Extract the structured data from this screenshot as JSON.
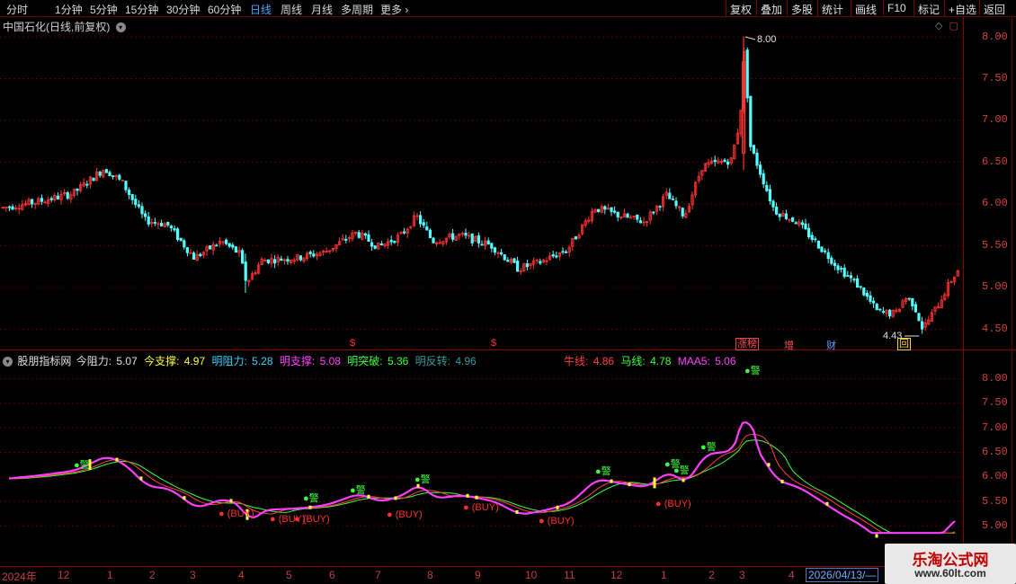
{
  "toolbar": {
    "periods": [
      "分时",
      "1分钟",
      "5分钟",
      "15分钟",
      "30分钟",
      "60分钟",
      "日线",
      "周线",
      "月线",
      "多周期",
      "更多"
    ],
    "active_period": "日线",
    "buttons": [
      "复权",
      "叠加",
      "多股",
      "统计",
      "画线",
      "F10",
      "标记",
      "+自选",
      "返回"
    ]
  },
  "main_chart": {
    "title": "中国石化(日线,前复权)",
    "high_label": "8.00",
    "low_label": "4.43",
    "y_ticks": [
      "8.00",
      "7.50",
      "7.00",
      "6.50",
      "6.00",
      "5.50",
      "5.00",
      "4.50"
    ],
    "badges": [
      {
        "text": "$",
        "color": "#ff3030"
      },
      {
        "text": "$",
        "color": "#ff3030"
      },
      {
        "text": "涨榜",
        "color": "#ff4040"
      },
      {
        "text": "增",
        "color": "#ff4040"
      },
      {
        "text": "财",
        "color": "#4a9aff"
      },
      {
        "text": "回",
        "color": "#ffd040"
      }
    ]
  },
  "indicator": {
    "name": "股朋指标网",
    "items": [
      {
        "label": "今阻力:",
        "value": "5.07",
        "color": "#e0e0e0"
      },
      {
        "label": "今支撑:",
        "value": "4.97",
        "color": "#ffff40"
      },
      {
        "label": "明阻力:",
        "value": "5.28",
        "color": "#40d0ff"
      },
      {
        "label": "明支撑:",
        "value": "5.08",
        "color": "#ff40ff"
      },
      {
        "label": "明突破:",
        "value": "5.36",
        "color": "#40ff40"
      },
      {
        "label": "明反转:",
        "value": "4.96",
        "color": "#2a8a8a"
      }
    ],
    "items_right": [
      {
        "label": "牛线:",
        "value": "4.86",
        "color": "#ff4040"
      },
      {
        "label": "马线:",
        "value": "4.78",
        "color": "#40ff40"
      },
      {
        "label": "MAA5:",
        "value": "5.06",
        "color": "#ff40ff"
      }
    ],
    "y_ticks": [
      "8.00",
      "7.50",
      "7.00",
      "6.50",
      "6.00",
      "5.50",
      "5.00"
    ],
    "buy_label": "(BUY)",
    "warn_label": "警"
  },
  "date_axis": {
    "labels": [
      "2024年",
      "12",
      "1",
      "2",
      "3",
      "4",
      "5",
      "6",
      "7",
      "8",
      "9",
      "10",
      "11",
      "12",
      "1",
      "2",
      "3",
      "4"
    ],
    "current_date": "2026/04/13/—"
  },
  "watermark": {
    "title": "乐淘公式网",
    "url": "www.60lt.com"
  },
  "colors": {
    "up": "#ff3232",
    "down": "#54ffff",
    "grid": "#5a0000",
    "maa5": "#ff40ff",
    "bull": "#ff4040",
    "horse": "#40ff40"
  }
}
